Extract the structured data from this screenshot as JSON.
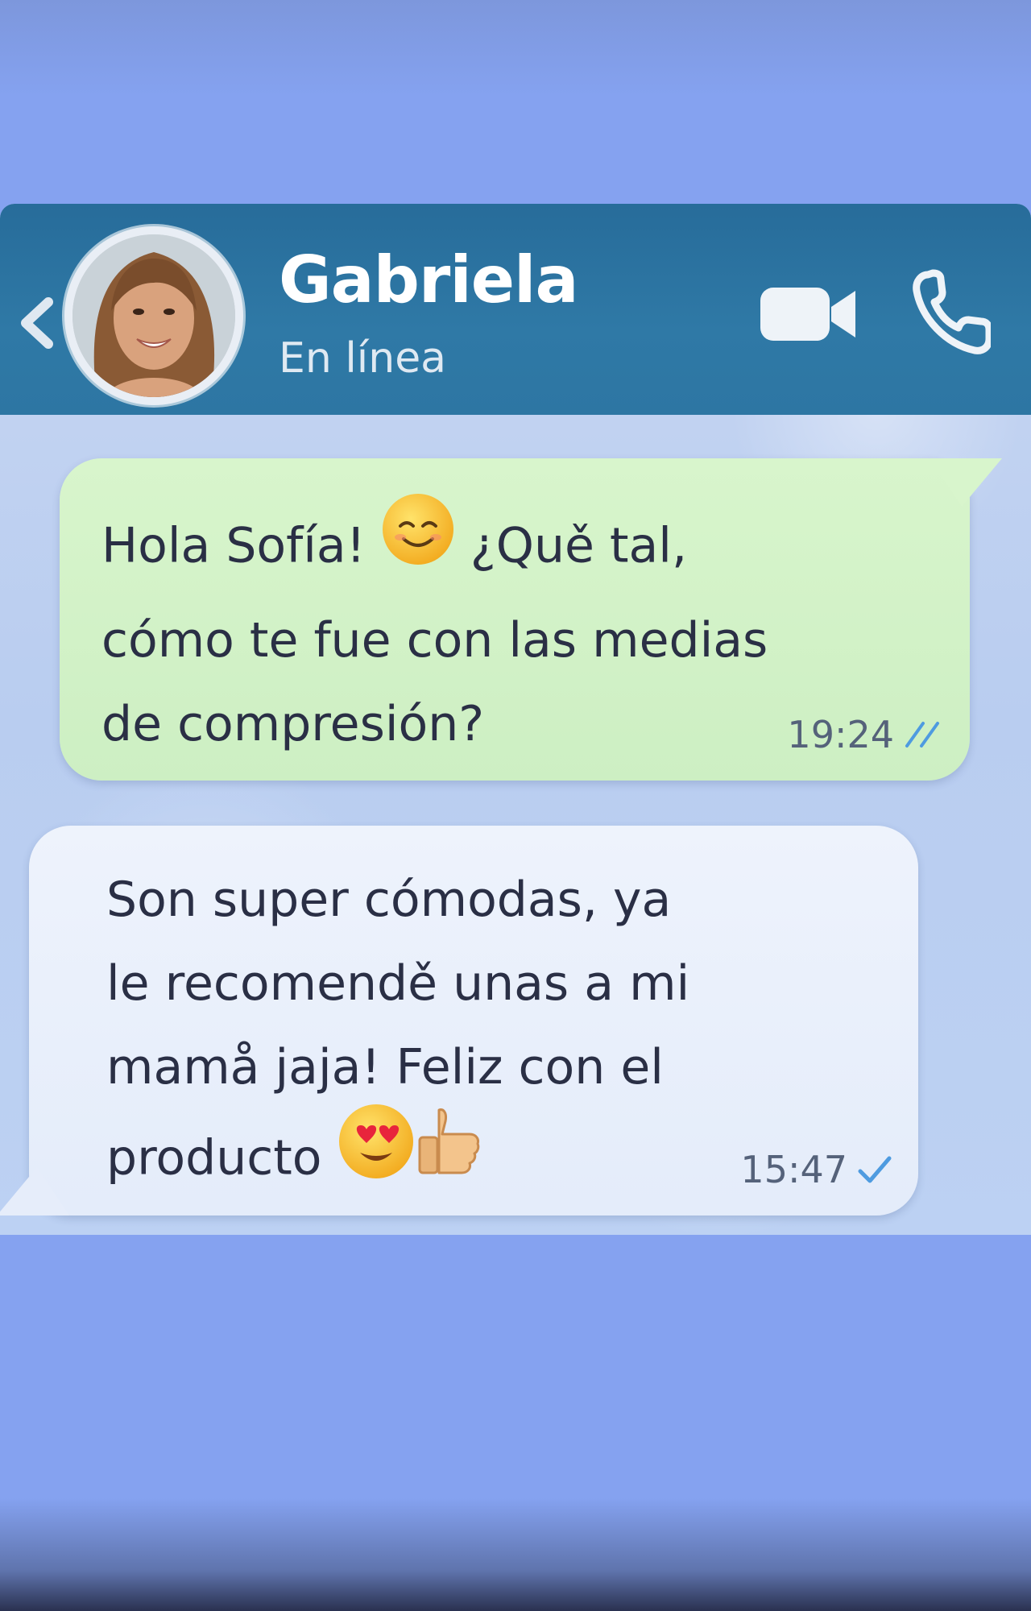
{
  "header": {
    "contact_name": "Gabriela",
    "status": "En línea",
    "icons": [
      "back-chevron-icon",
      "avatar-photo",
      "video-camera-icon",
      "phone-icon"
    ]
  },
  "messages": [
    {
      "direction": "outgoing",
      "line1_a": "Hola Sofía! ",
      "emoji1": "smiling-face-emoji",
      "line1_b": " ¿Quě tal,",
      "line2": "cómo te fue con las medias",
      "line3": "de compresión?",
      "time": "19:24",
      "status_icon": "double-check-icon"
    },
    {
      "direction": "incoming",
      "line1": "Son super cómodas, ya",
      "line2": "le recomendě unas a mi",
      "line3": "mamå jaja! Feliz con el",
      "line4": "producto ",
      "emoji1": "heart-eyes-emoji",
      "emoji2": "thumbs-up-emoji",
      "time": "15:47",
      "status_icon": "single-check-icon"
    }
  ],
  "colors": {
    "page_background": "#85a2f0",
    "header_background": "#2d76a3",
    "outgoing_bubble": "#d3f2c7",
    "incoming_bubble": "#e9effb",
    "text": "#2a2f45",
    "tick": "#4e9be0"
  }
}
